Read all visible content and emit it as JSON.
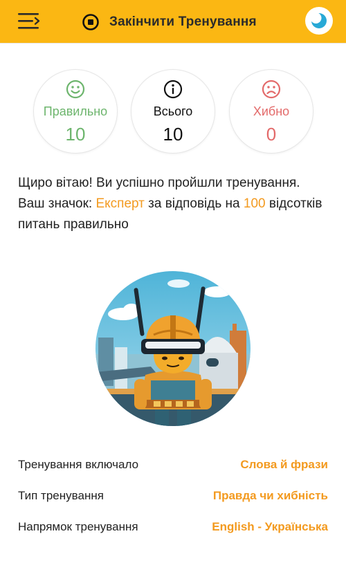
{
  "header": {
    "end_training_label": "Закінчити Тренування"
  },
  "stats": {
    "correct": {
      "label": "Правильно",
      "value": "10",
      "color": "#6db56d"
    },
    "total": {
      "label": "Всього",
      "value": "10",
      "color": "#111111"
    },
    "wrong": {
      "label": "Хибно",
      "value": "0",
      "color": "#e36a6a"
    }
  },
  "message": {
    "part1": "Щиро вітаю! Ви успішно пройшли тренування. Ваш значок: ",
    "badge_name": "Експерт",
    "part2": " за відповідь на ",
    "percent": "100",
    "part3": " відсотків питань правильно"
  },
  "details": [
    {
      "label": "Тренування включало",
      "value": "Слова й фрази"
    },
    {
      "label": "Тип тренування",
      "value": "Правда чи хибність"
    },
    {
      "label": "Напрямок тренування",
      "value": "English - Українська"
    }
  ],
  "colors": {
    "accent": "#fbb713",
    "highlight": "#f39a1f"
  },
  "icons": {
    "menu": "menu-icon",
    "stop": "stop-circle-icon",
    "theme": "moon-theme-icon",
    "correct": "smile-icon",
    "total": "info-icon",
    "wrong": "sad-icon"
  }
}
